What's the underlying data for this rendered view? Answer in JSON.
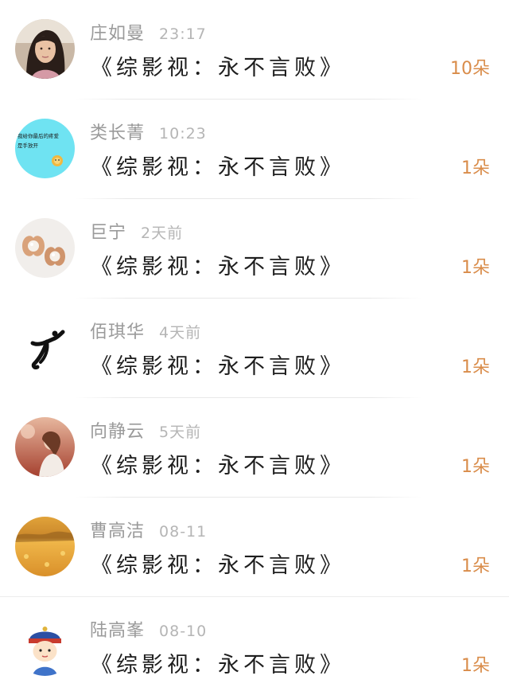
{
  "rewards": [
    {
      "name": "庄如曼",
      "time": "23:17",
      "book": "《综影视：永不言败》",
      "count": "10朵",
      "avatar_icon": "woman-portrait-avatar"
    },
    {
      "name": "类长菁",
      "time": "10:23",
      "book": "《综影视：永不言败》",
      "count": "1朵",
      "avatar_icon": "cyan-text-avatar",
      "avatar_text": [
        "我给你最后的疼爱",
        "是手放开"
      ]
    },
    {
      "name": "巨宁",
      "time": "2天前",
      "book": "《综影视：永不言败》",
      "count": "1朵",
      "avatar_icon": "pearl-earring-avatar"
    },
    {
      "name": "佰琪华",
      "time": "4天前",
      "book": "《综影视：永不言败》",
      "count": "1朵",
      "avatar_icon": "dancer-logo-avatar"
    },
    {
      "name": "向静云",
      "time": "5天前",
      "book": "《综影视：永不言败》",
      "count": "1朵",
      "avatar_icon": "autumn-girl-avatar"
    },
    {
      "name": "曹高洁",
      "time": "08-11",
      "book": "《综影视：永不言败》",
      "count": "1朵",
      "avatar_icon": "autumn-leaves-avatar"
    },
    {
      "name": "陆高峯",
      "time": "08-10",
      "book": "《综影视：永不言败》",
      "count": "1朵",
      "avatar_icon": "cartoon-emperor-avatar"
    }
  ],
  "colors": {
    "count_accent": "#d98c4a",
    "name_gray": "#9a9a9a",
    "time_gray": "#b5b5b5"
  }
}
